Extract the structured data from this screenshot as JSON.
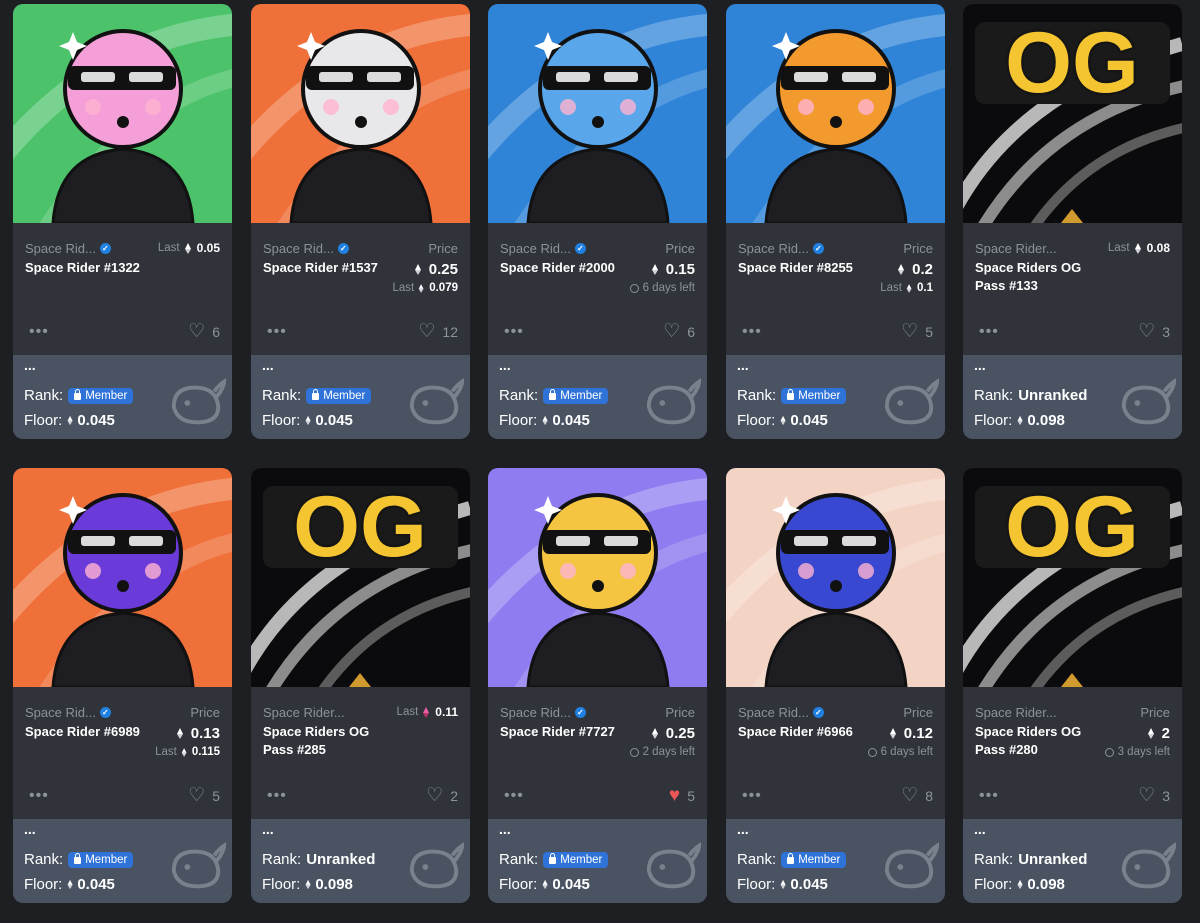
{
  "cards": [
    {
      "collection": "Space Rid...",
      "verified": true,
      "name": "Space Rider #1322",
      "price_label": "",
      "price": "",
      "last_label": "Last",
      "last": "0.05",
      "time_left": "",
      "likes": "6",
      "liked": false,
      "ext_dots": "...",
      "rank_label": "Rank:",
      "rank": "Member",
      "rank_is_badge": true,
      "floor_label": "Floor:",
      "floor": "0.045",
      "bg": "#4cc36a",
      "skin": "#f49fd8"
    },
    {
      "collection": "Space Rid...",
      "verified": true,
      "name": "Space Rider #1537",
      "price_label": "Price",
      "price": "0.25",
      "last_label": "Last",
      "last": "0.079",
      "time_left": "",
      "likes": "12",
      "liked": false,
      "ext_dots": "...",
      "rank_label": "Rank:",
      "rank": "Member",
      "rank_is_badge": true,
      "floor_label": "Floor:",
      "floor": "0.045",
      "bg": "#f0703a",
      "skin": "#e8e8ea"
    },
    {
      "collection": "Space Rid...",
      "verified": true,
      "name": "Space Rider #2000",
      "price_label": "Price",
      "price": "0.15",
      "last_label": "",
      "last": "",
      "time_left": "6 days left",
      "likes": "6",
      "liked": false,
      "ext_dots": "...",
      "rank_label": "Rank:",
      "rank": "Member",
      "rank_is_badge": true,
      "floor_label": "Floor:",
      "floor": "0.045",
      "bg": "#2f84d8",
      "skin": "#5aa6ea"
    },
    {
      "collection": "Space Rid...",
      "verified": true,
      "name": "Space Rider #8255",
      "price_label": "Price",
      "price": "0.2",
      "last_label": "Last",
      "last": "0.1",
      "time_left": "",
      "likes": "5",
      "liked": false,
      "ext_dots": "...",
      "rank_label": "Rank:",
      "rank": "Member",
      "rank_is_badge": true,
      "floor_label": "Floor:",
      "floor": "0.045",
      "bg": "#2f84d8",
      "skin": "#f39a2e"
    },
    {
      "collection": "Space Rider...",
      "verified": false,
      "name": "Space Riders OG Pass #133",
      "price_label": "",
      "price": "",
      "last_label": "Last",
      "last": "0.08",
      "time_left": "",
      "likes": "3",
      "liked": false,
      "ext_dots": "...",
      "rank_label": "Rank:",
      "rank": "Unranked",
      "rank_is_badge": false,
      "floor_label": "Floor:",
      "floor": "0.098",
      "bg": "#0c0c0e",
      "og": true,
      "og_text": "OG"
    },
    {
      "collection": "Space Rid...",
      "verified": true,
      "name": "Space Rider #6989",
      "price_label": "Price",
      "price": "0.13",
      "last_label": "Last",
      "last": "0.115",
      "time_left": "",
      "likes": "5",
      "liked": false,
      "ext_dots": "...",
      "rank_label": "Rank:",
      "rank": "Member",
      "rank_is_badge": true,
      "floor_label": "Floor:",
      "floor": "0.045",
      "bg": "#f0703a",
      "skin": "#6a3bd8"
    },
    {
      "collection": "Space Rider...",
      "verified": false,
      "name": "Space Riders OG Pass #285",
      "price_label": "",
      "price": "",
      "last_label": "Last",
      "last": "0.11",
      "last_pink": true,
      "time_left": "",
      "likes": "2",
      "liked": false,
      "ext_dots": "...",
      "rank_label": "Rank:",
      "rank": "Unranked",
      "rank_is_badge": false,
      "floor_label": "Floor:",
      "floor": "0.098",
      "bg": "#0c0c0e",
      "og": true,
      "og_text": "OG"
    },
    {
      "collection": "Space Rid...",
      "verified": true,
      "name": "Space Rider #7727",
      "price_label": "Price",
      "price": "0.25",
      "last_label": "",
      "last": "",
      "time_left": "2 days left",
      "likes": "5",
      "liked": true,
      "ext_dots": "...",
      "rank_label": "Rank:",
      "rank": "Member",
      "rank_is_badge": true,
      "floor_label": "Floor:",
      "floor": "0.045",
      "bg": "#8e7cf0",
      "skin": "#f5c542"
    },
    {
      "collection": "Space Rid...",
      "verified": true,
      "name": "Space Rider #6966",
      "price_label": "Price",
      "price": "0.12",
      "last_label": "",
      "last": "",
      "time_left": "6 days left",
      "likes": "8",
      "liked": false,
      "ext_dots": "...",
      "rank_label": "Rank:",
      "rank": "Member",
      "rank_is_badge": true,
      "floor_label": "Floor:",
      "floor": "0.045",
      "bg": "#f3d3c4",
      "skin": "#3848d0"
    },
    {
      "collection": "Space Rider...",
      "verified": false,
      "name": "Space Riders OG Pass #280",
      "price_label": "Price",
      "price": "2",
      "last_label": "",
      "last": "",
      "time_left": "3 days left",
      "likes": "3",
      "liked": false,
      "ext_dots": "...",
      "rank_label": "Rank:",
      "rank": "Unranked",
      "rank_is_badge": false,
      "floor_label": "Floor:",
      "floor": "0.098",
      "bg": "#0c0c0e",
      "og": true,
      "og_text": "OG"
    }
  ],
  "icons": {
    "more": "more-dots-icon",
    "like": "heart-icon",
    "eth": "ethereum-icon",
    "verified": "verified-badge-icon",
    "lock": "lock-icon",
    "clock": "clock-icon",
    "watermark": "whale-logo-icon"
  }
}
